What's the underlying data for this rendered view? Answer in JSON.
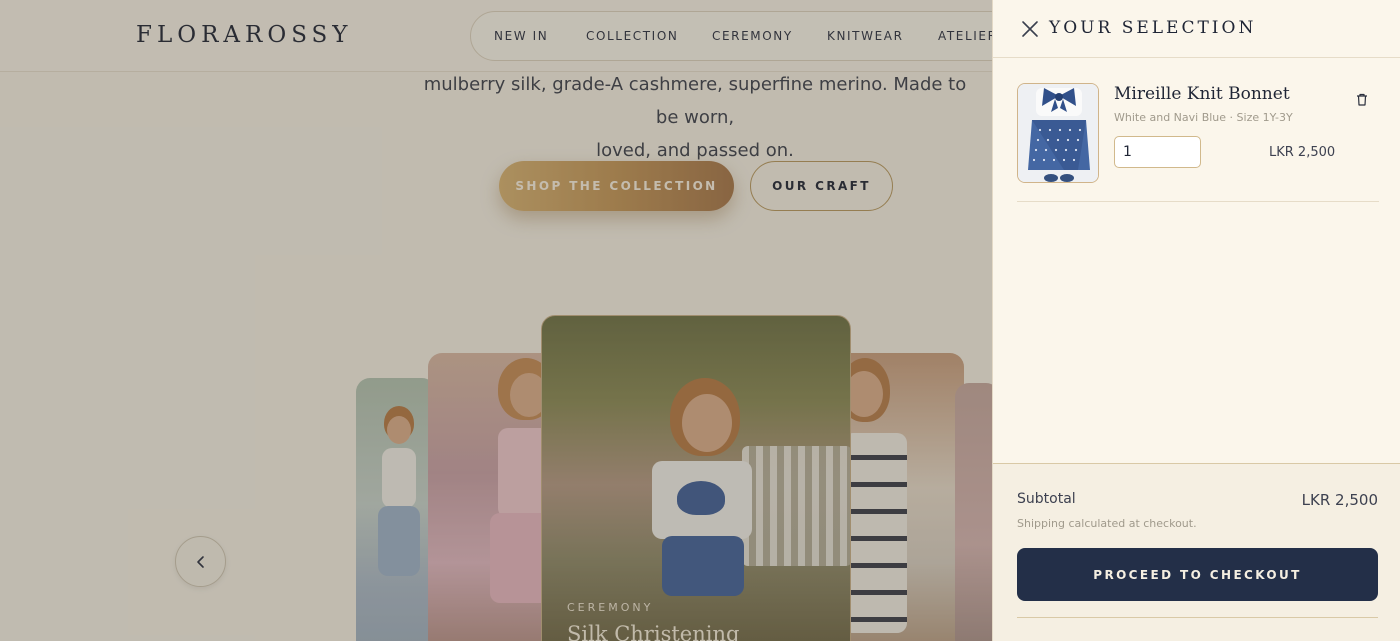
{
  "brand": {
    "logo": "FLORAROSSY"
  },
  "nav": {
    "items": [
      "NEW IN",
      "COLLECTION",
      "CEREMONY",
      "KNITWEAR",
      "ATELIER"
    ]
  },
  "hero": {
    "description_line1": "mulberry silk, grade-A cashmere, superfine merino. Made to be worn,",
    "description_line2": "loved, and passed on.",
    "primary_button": "SHOP THE COLLECTION",
    "secondary_button": "OUR CRAFT"
  },
  "carousel": {
    "featured_eyebrow": "CEREMONY",
    "featured_title": "Silk Christening"
  },
  "cart": {
    "title": "YOUR SELECTION",
    "items": [
      {
        "name": "Mireille Knit Bonnet",
        "variant": "White and Navi Blue · Size 1Y-3Y",
        "quantity": "1",
        "price": "LKR 2,500"
      }
    ],
    "subtotal_label": "Subtotal",
    "subtotal_value": "LKR 2,500",
    "shipping_note": "Shipping calculated at checkout.",
    "checkout_button": "PROCEED TO CHECKOUT"
  },
  "icons": {
    "close": "close-icon",
    "trash": "trash-icon",
    "carousel_prev": "chevron-left-icon"
  },
  "colors": {
    "navy": "#232f48",
    "gold": "#c39658",
    "cream": "#fbf6eb"
  }
}
